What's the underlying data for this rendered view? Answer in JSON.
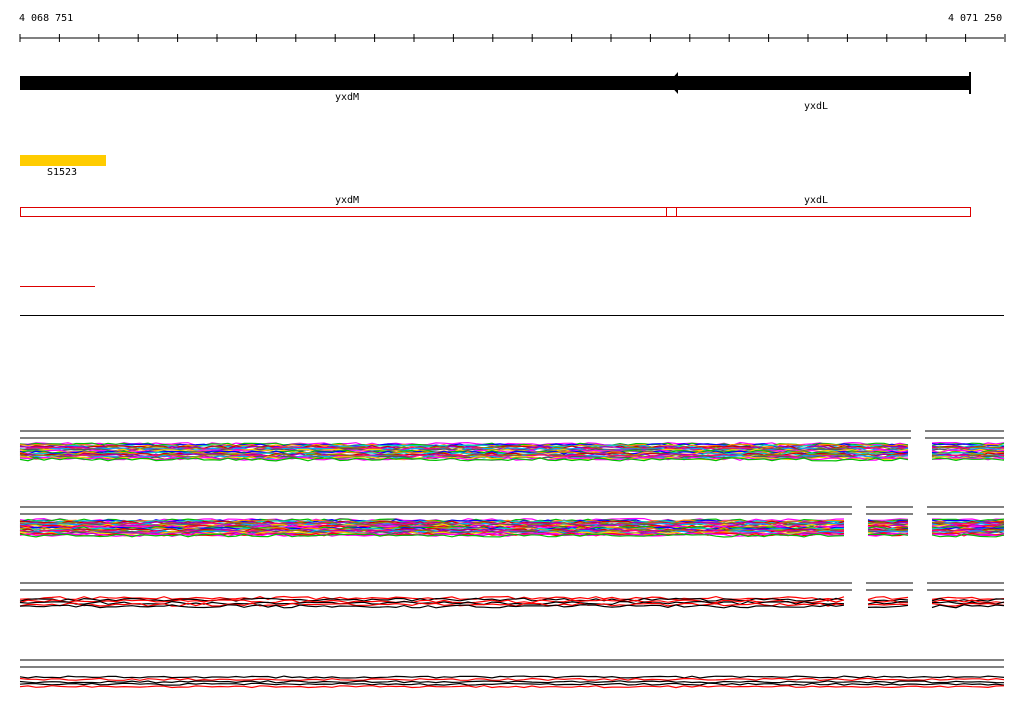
{
  "ruler": {
    "start_label": "4 068 751",
    "end_label": "4 071 250"
  },
  "genes": [
    {
      "name": "yxdM",
      "strand": "reverse"
    },
    {
      "name": "yxdL",
      "strand": "reverse"
    }
  ],
  "feature": {
    "name": "S1523",
    "color": "#ffcc00"
  },
  "cds_track": {
    "labels": [
      "yxdM",
      "yxdL"
    ],
    "color": "#dd0000"
  },
  "colors": {
    "gene_arrow": "#000000",
    "axis": "#000000",
    "accent_red": "#dd0000"
  }
}
